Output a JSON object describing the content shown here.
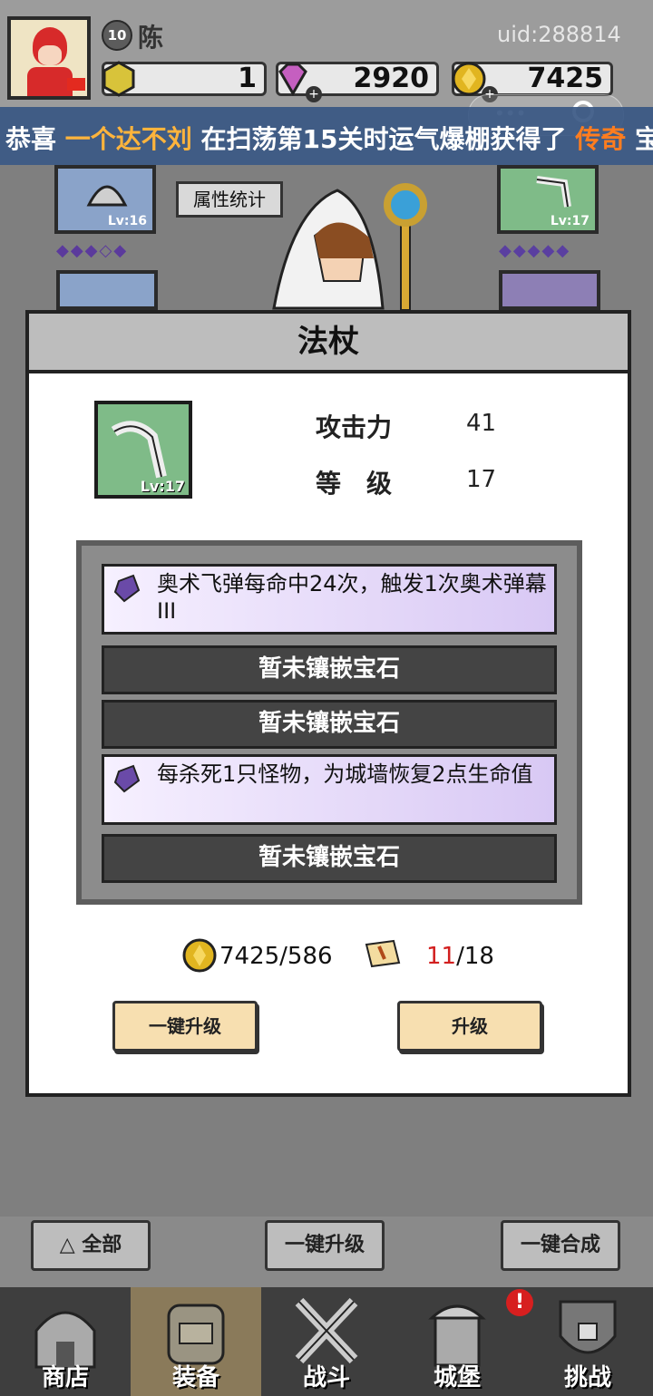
{
  "player": {
    "level": "10",
    "name": "陈",
    "uid": "uid:288814"
  },
  "resources": {
    "gold_bar": "1",
    "gems": "2920",
    "coins": "7425"
  },
  "marquee": {
    "prefix": "恭喜",
    "player": "一个达不刘",
    "middle": "在扫荡第15关时运气爆棚获得了",
    "item": "传奇",
    "suffix": "宝"
  },
  "scene": {
    "attr_button": "属性统计",
    "slot_left_top_lv": "Lv:16",
    "slot_right_top_lv": "Lv:17"
  },
  "modal": {
    "title": "法杖",
    "icon_level": "Lv:17",
    "attack_label": "攻击力",
    "attack_value": "41",
    "level_label": "等　级",
    "level_value": "17",
    "gem_slots": [
      {
        "text": "奥术飞弹每命中24次，触发1次奥术弹幕III"
      },
      {
        "text": "暂未镶嵌宝石"
      },
      {
        "text": "暂未镶嵌宝石"
      },
      {
        "text": "每杀死1只怪物，为城墙恢复2点生命值"
      },
      {
        "text": "暂未镶嵌宝石"
      }
    ],
    "coin_cost": "7425/586",
    "scroll_have": "11",
    "scroll_need": "/18",
    "btn_quick_upgrade": "一键升级",
    "btn_upgrade": "升级"
  },
  "bottom_buttons": {
    "all": "全部",
    "quick_upgrade": "一键升级",
    "quick_merge": "一键合成"
  },
  "tabs": [
    {
      "label": "商店"
    },
    {
      "label": "装备"
    },
    {
      "label": "战斗"
    },
    {
      "label": "城堡"
    },
    {
      "label": "挑战"
    }
  ],
  "alert": "!"
}
